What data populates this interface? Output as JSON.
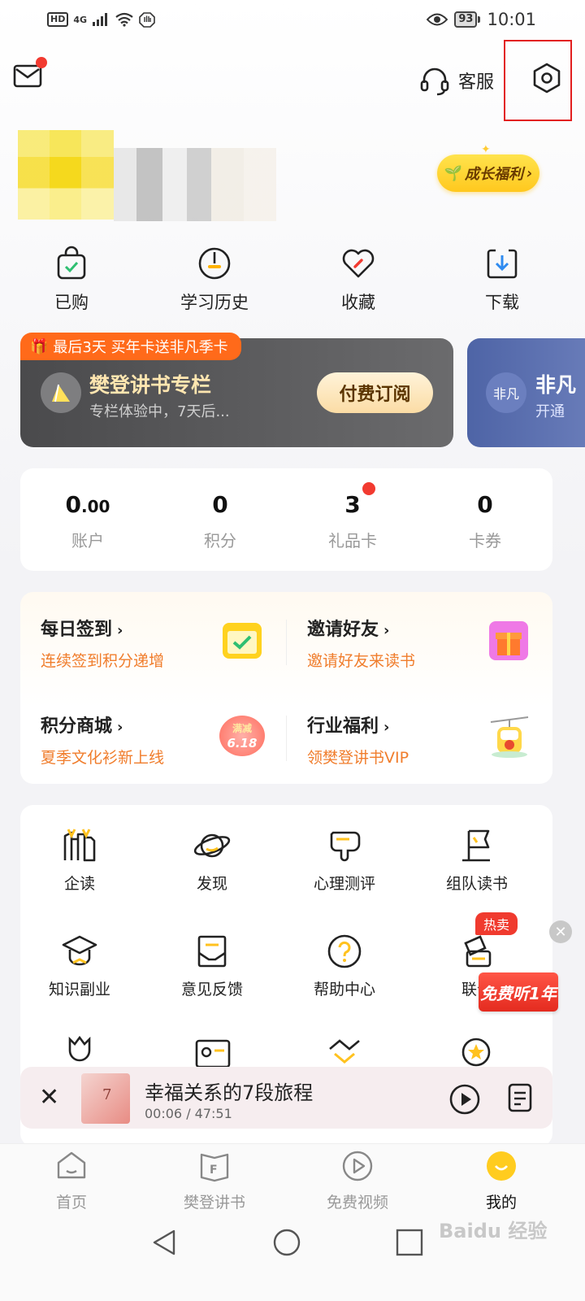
{
  "status_bar": {
    "left_badges": [
      "HD",
      "4G"
    ],
    "battery": "93",
    "time": "10:01"
  },
  "header": {
    "service_label": "客服"
  },
  "profile": {
    "growth_label": "成长福利"
  },
  "quick_actions": [
    {
      "label": "已购",
      "icon": "purchased-bag-icon"
    },
    {
      "label": "学习历史",
      "icon": "history-clock-icon"
    },
    {
      "label": "收藏",
      "icon": "favorite-heart-icon"
    },
    {
      "label": "下载",
      "icon": "download-icon"
    }
  ],
  "vip_card": {
    "promo": "最后3天 买年卡送非凡季卡",
    "title": "樊登讲书专栏",
    "subtitle": "专栏体验中，7天后...",
    "button": "付费订阅",
    "logo_text": "",
    "second_logo": "非凡",
    "second_title": "非凡",
    "second_subtitle": "开通"
  },
  "assets": [
    {
      "value_int": "0",
      "value_dec": ".00",
      "label": "账户"
    },
    {
      "value_int": "0",
      "value_dec": "",
      "label": "积分"
    },
    {
      "value_int": "3",
      "value_dec": "",
      "label": "礼品卡"
    },
    {
      "value_int": "0",
      "value_dec": "",
      "label": "卡券"
    }
  ],
  "tasks": [
    {
      "title": "每日签到",
      "subtitle": "连续签到积分递增"
    },
    {
      "title": "邀请好友",
      "subtitle": "邀请好友来读书"
    },
    {
      "title": "积分商城",
      "subtitle": "夏季文化衫新上线"
    },
    {
      "title": "行业福利",
      "subtitle": "领樊登讲书VIP"
    }
  ],
  "promo_badge": {
    "line1": "满减",
    "line2": "6.18"
  },
  "grid": [
    {
      "label": "企读",
      "icon": "enterprise-read-icon"
    },
    {
      "label": "发现",
      "icon": "planet-discover-icon"
    },
    {
      "label": "心理测评",
      "icon": "psychology-test-icon"
    },
    {
      "label": "组队读书",
      "icon": "team-flag-icon"
    },
    {
      "label": "知识副业",
      "icon": "graduation-cap-icon"
    },
    {
      "label": "意见反馈",
      "icon": "feedback-envelope-icon"
    },
    {
      "label": "帮助中心",
      "icon": "help-question-icon"
    },
    {
      "label": "联合",
      "icon": "joint-card-icon"
    }
  ],
  "hot_badge": "热卖",
  "free_badge": "免费听1年",
  "player": {
    "title": "幸福关系的7段旅程",
    "time": "00:06 / 47:51",
    "cover_num": "7"
  },
  "tabs": [
    {
      "label": "首页",
      "active": false
    },
    {
      "label": "樊登讲书",
      "active": false
    },
    {
      "label": "免费视频",
      "active": false
    },
    {
      "label": "我的",
      "active": true
    }
  ],
  "watermark": "Baidu 经验",
  "colors": {
    "accent_orange": "#f07d2c",
    "badge_red": "#f23a30",
    "vip_gold": "#ffe6b0",
    "highlight_red": "#e21f1f"
  }
}
